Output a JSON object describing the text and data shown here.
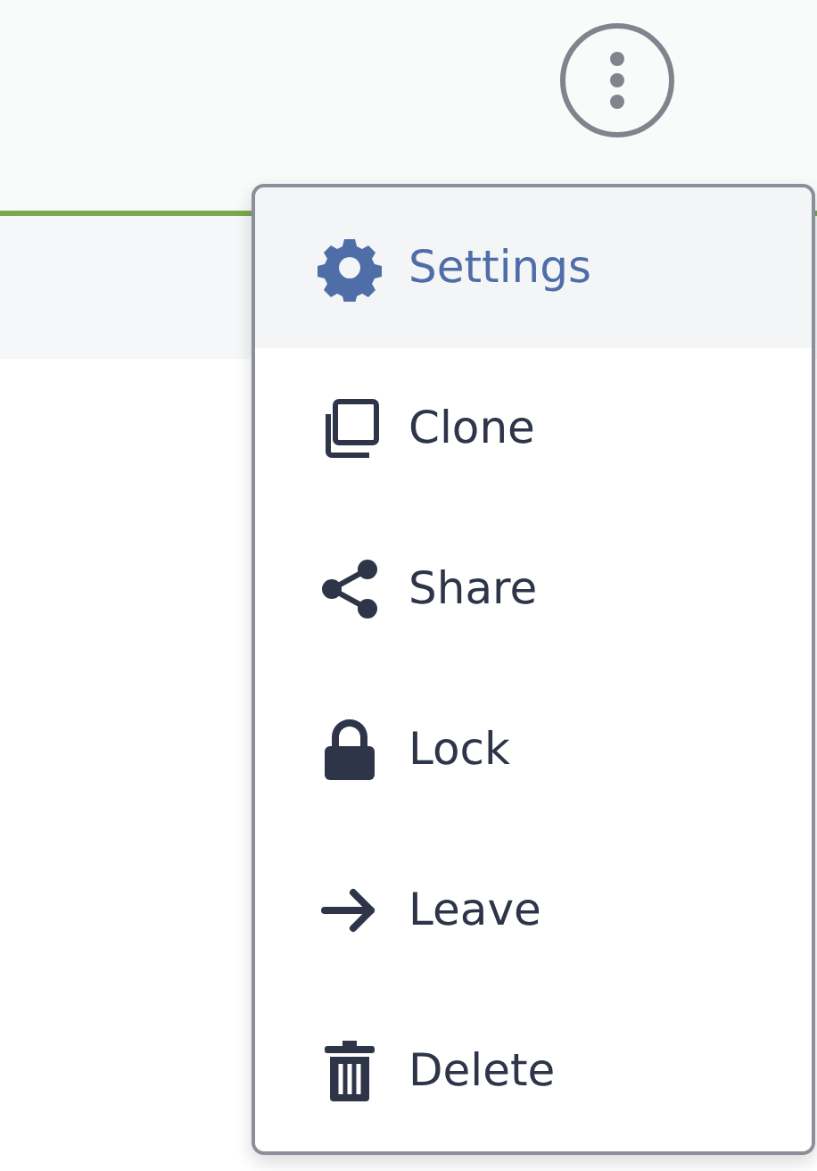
{
  "menu": {
    "items": [
      {
        "label": "Settings",
        "kind": "gear",
        "selected": true
      },
      {
        "label": "Clone",
        "kind": "clone",
        "selected": false
      },
      {
        "label": "Share",
        "kind": "share",
        "selected": false
      },
      {
        "label": "Lock",
        "kind": "lock",
        "selected": false
      },
      {
        "label": "Leave",
        "kind": "arrow",
        "selected": false
      },
      {
        "label": "Delete",
        "kind": "trash",
        "selected": false
      }
    ]
  }
}
